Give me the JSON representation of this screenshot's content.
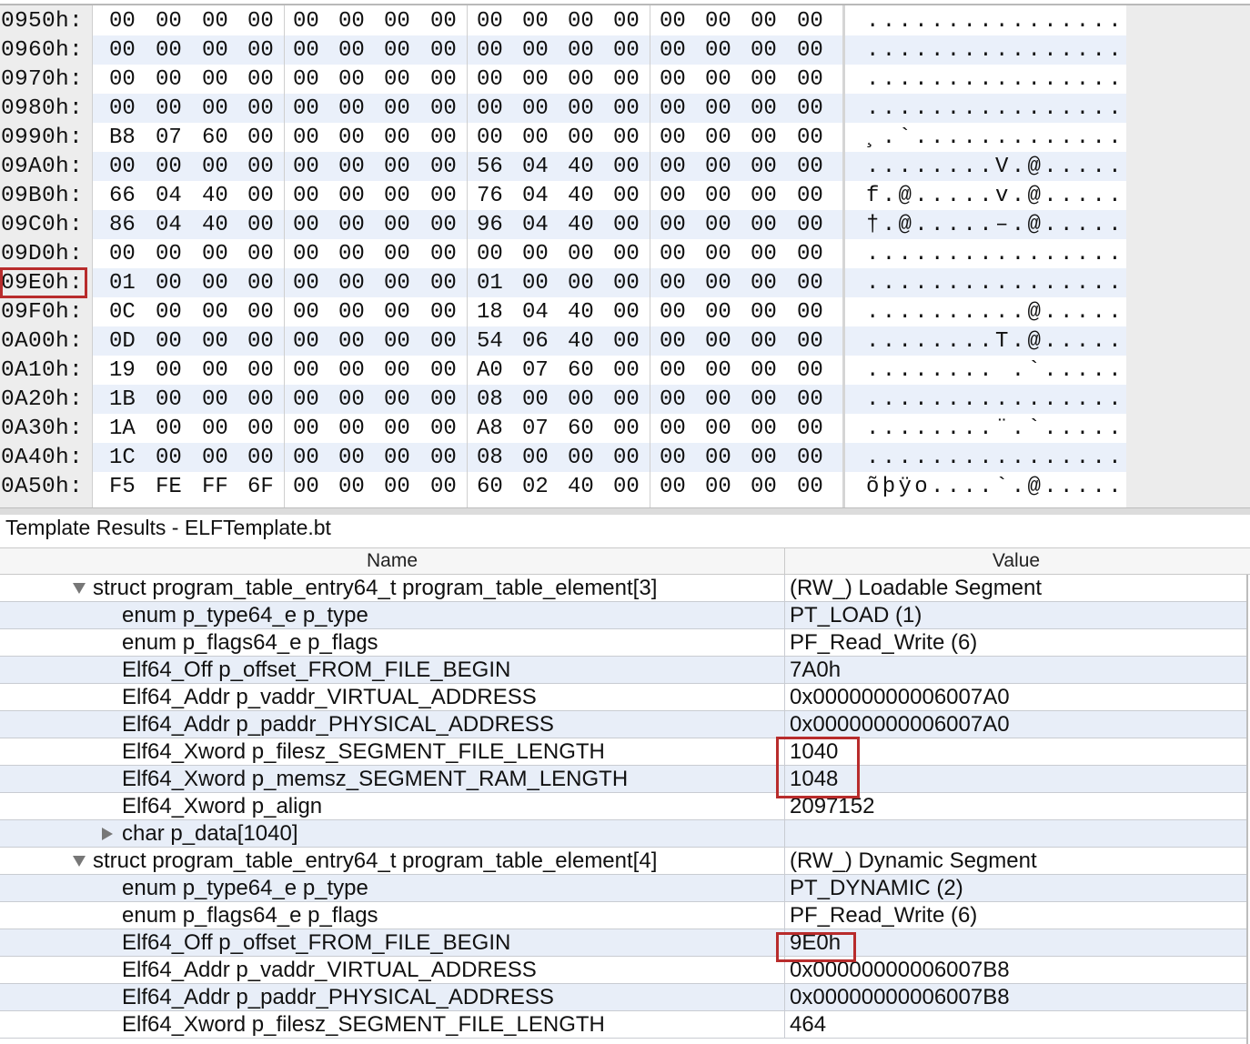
{
  "hex_view": {
    "rows": [
      {
        "addr": "0950h:",
        "bytes": [
          "00",
          "00",
          "00",
          "00",
          "00",
          "00",
          "00",
          "00",
          "00",
          "00",
          "00",
          "00",
          "00",
          "00",
          "00",
          "00"
        ],
        "ascii": "................"
      },
      {
        "addr": "0960h:",
        "bytes": [
          "00",
          "00",
          "00",
          "00",
          "00",
          "00",
          "00",
          "00",
          "00",
          "00",
          "00",
          "00",
          "00",
          "00",
          "00",
          "00"
        ],
        "ascii": "................"
      },
      {
        "addr": "0970h:",
        "bytes": [
          "00",
          "00",
          "00",
          "00",
          "00",
          "00",
          "00",
          "00",
          "00",
          "00",
          "00",
          "00",
          "00",
          "00",
          "00",
          "00"
        ],
        "ascii": "................"
      },
      {
        "addr": "0980h:",
        "bytes": [
          "00",
          "00",
          "00",
          "00",
          "00",
          "00",
          "00",
          "00",
          "00",
          "00",
          "00",
          "00",
          "00",
          "00",
          "00",
          "00"
        ],
        "ascii": "................"
      },
      {
        "addr": "0990h:",
        "bytes": [
          "B8",
          "07",
          "60",
          "00",
          "00",
          "00",
          "00",
          "00",
          "00",
          "00",
          "00",
          "00",
          "00",
          "00",
          "00",
          "00"
        ],
        "ascii": "¸.`............."
      },
      {
        "addr": "09A0h:",
        "bytes": [
          "00",
          "00",
          "00",
          "00",
          "00",
          "00",
          "00",
          "00",
          "56",
          "04",
          "40",
          "00",
          "00",
          "00",
          "00",
          "00"
        ],
        "ascii": "........V.@....."
      },
      {
        "addr": "09B0h:",
        "bytes": [
          "66",
          "04",
          "40",
          "00",
          "00",
          "00",
          "00",
          "00",
          "76",
          "04",
          "40",
          "00",
          "00",
          "00",
          "00",
          "00"
        ],
        "ascii": "f.@.....v.@....."
      },
      {
        "addr": "09C0h:",
        "bytes": [
          "86",
          "04",
          "40",
          "00",
          "00",
          "00",
          "00",
          "00",
          "96",
          "04",
          "40",
          "00",
          "00",
          "00",
          "00",
          "00"
        ],
        "ascii": "†.@.....–.@....."
      },
      {
        "addr": "09D0h:",
        "bytes": [
          "00",
          "00",
          "00",
          "00",
          "00",
          "00",
          "00",
          "00",
          "00",
          "00",
          "00",
          "00",
          "00",
          "00",
          "00",
          "00"
        ],
        "ascii": "................"
      },
      {
        "addr": "09E0h:",
        "bytes": [
          "01",
          "00",
          "00",
          "00",
          "00",
          "00",
          "00",
          "00",
          "01",
          "00",
          "00",
          "00",
          "00",
          "00",
          "00",
          "00"
        ],
        "ascii": "................"
      },
      {
        "addr": "09F0h:",
        "bytes": [
          "0C",
          "00",
          "00",
          "00",
          "00",
          "00",
          "00",
          "00",
          "18",
          "04",
          "40",
          "00",
          "00",
          "00",
          "00",
          "00"
        ],
        "ascii": "..........@....."
      },
      {
        "addr": "0A00h:",
        "bytes": [
          "0D",
          "00",
          "00",
          "00",
          "00",
          "00",
          "00",
          "00",
          "54",
          "06",
          "40",
          "00",
          "00",
          "00",
          "00",
          "00"
        ],
        "ascii": "........T.@....."
      },
      {
        "addr": "0A10h:",
        "bytes": [
          "19",
          "00",
          "00",
          "00",
          "00",
          "00",
          "00",
          "00",
          "A0",
          "07",
          "60",
          "00",
          "00",
          "00",
          "00",
          "00"
        ],
        "ascii": "........ .`....."
      },
      {
        "addr": "0A20h:",
        "bytes": [
          "1B",
          "00",
          "00",
          "00",
          "00",
          "00",
          "00",
          "00",
          "08",
          "00",
          "00",
          "00",
          "00",
          "00",
          "00",
          "00"
        ],
        "ascii": "................"
      },
      {
        "addr": "0A30h:",
        "bytes": [
          "1A",
          "00",
          "00",
          "00",
          "00",
          "00",
          "00",
          "00",
          "A8",
          "07",
          "60",
          "00",
          "00",
          "00",
          "00",
          "00"
        ],
        "ascii": "........¨.`....."
      },
      {
        "addr": "0A40h:",
        "bytes": [
          "1C",
          "00",
          "00",
          "00",
          "00",
          "00",
          "00",
          "00",
          "08",
          "00",
          "00",
          "00",
          "00",
          "00",
          "00",
          "00"
        ],
        "ascii": "................"
      },
      {
        "addr": "0A50h:",
        "bytes": [
          "F5",
          "FE",
          "FF",
          "6F",
          "00",
          "00",
          "00",
          "00",
          "60",
          "02",
          "40",
          "00",
          "00",
          "00",
          "00",
          "00"
        ],
        "ascii": "õþÿo....`.@....."
      }
    ],
    "selected_addr": "09E0h:"
  },
  "template": {
    "title": "Template Results - ELFTemplate.bt",
    "columns": {
      "name": "Name",
      "value": "Value"
    },
    "rows": [
      {
        "name": "struct program_table_entry64_t program_table_element[3]",
        "value": "(RW_) Loadable Segment",
        "indent": "l1",
        "toggle": "expanded"
      },
      {
        "name": "enum p_type64_e p_type",
        "value": "PT_LOAD (1)",
        "indent": "l2",
        "toggle": "none"
      },
      {
        "name": "enum p_flags64_e p_flags",
        "value": "PF_Read_Write (6)",
        "indent": "l2",
        "toggle": "none"
      },
      {
        "name": "Elf64_Off p_offset_FROM_FILE_BEGIN",
        "value": "7A0h",
        "indent": "l2",
        "toggle": "none"
      },
      {
        "name": "Elf64_Addr p_vaddr_VIRTUAL_ADDRESS",
        "value": "0x00000000006007A0",
        "indent": "l2",
        "toggle": "none"
      },
      {
        "name": "Elf64_Addr p_paddr_PHYSICAL_ADDRESS",
        "value": "0x00000000006007A0",
        "indent": "l2",
        "toggle": "none"
      },
      {
        "name": "Elf64_Xword p_filesz_SEGMENT_FILE_LENGTH",
        "value": "1040",
        "indent": "l2",
        "toggle": "none"
      },
      {
        "name": "Elf64_Xword p_memsz_SEGMENT_RAM_LENGTH",
        "value": "1048",
        "indent": "l2",
        "toggle": "none"
      },
      {
        "name": "Elf64_Xword p_align",
        "value": "2097152",
        "indent": "l2",
        "toggle": "none"
      },
      {
        "name": "char p_data[1040]",
        "value": "",
        "indent": "l2",
        "toggle": "collapsed"
      },
      {
        "name": "struct program_table_entry64_t program_table_element[4]",
        "value": "(RW_) Dynamic Segment",
        "indent": "l1",
        "toggle": "expanded"
      },
      {
        "name": "enum p_type64_e p_type",
        "value": "PT_DYNAMIC (2)",
        "indent": "l2",
        "toggle": "none"
      },
      {
        "name": "enum p_flags64_e p_flags",
        "value": "PF_Read_Write (6)",
        "indent": "l2",
        "toggle": "none"
      },
      {
        "name": "Elf64_Off p_offset_FROM_FILE_BEGIN",
        "value": "9E0h",
        "indent": "l2",
        "toggle": "none"
      },
      {
        "name": "Elf64_Addr p_vaddr_VIRTUAL_ADDRESS",
        "value": "0x00000000006007B8",
        "indent": "l2",
        "toggle": "none"
      },
      {
        "name": "Elf64_Addr p_paddr_PHYSICAL_ADDRESS",
        "value": "0x00000000006007B8",
        "indent": "l2",
        "toggle": "none"
      },
      {
        "name": "Elf64_Xword p_filesz_SEGMENT_FILE_LENGTH",
        "value": "464",
        "indent": "l2",
        "toggle": "none"
      }
    ]
  },
  "colors": {
    "highlight_box": "#b82c2c",
    "row_alt": "#e8eef8",
    "hex_row_alt": "#eaf0fa"
  }
}
